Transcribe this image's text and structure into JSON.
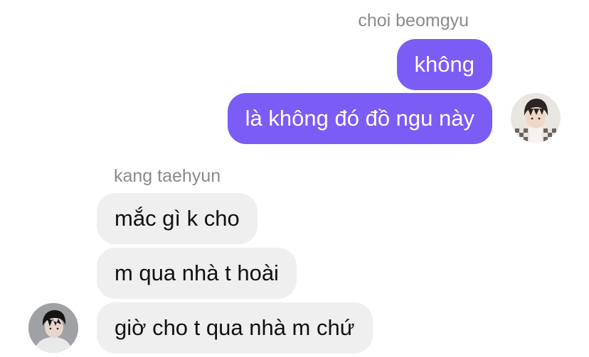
{
  "conversation": {
    "outgoing": {
      "sender_name": "choi beomgyu",
      "messages": [
        {
          "text": "không"
        },
        {
          "text": "là không đó đồ ngu này"
        }
      ],
      "avatar_icon": "user-avatar-photo"
    },
    "incoming": {
      "sender_name": "kang taehyun",
      "messages": [
        {
          "text": "mắc gì k cho"
        },
        {
          "text": "m qua nhà t hoài"
        },
        {
          "text": "giờ cho t qua nhà m chứ"
        }
      ],
      "avatar_icon": "user-avatar-photo"
    }
  },
  "colors": {
    "outgoing_bubble": "#7b5cf5",
    "incoming_bubble": "#efefef",
    "sender_name": "#8a8a8e"
  }
}
